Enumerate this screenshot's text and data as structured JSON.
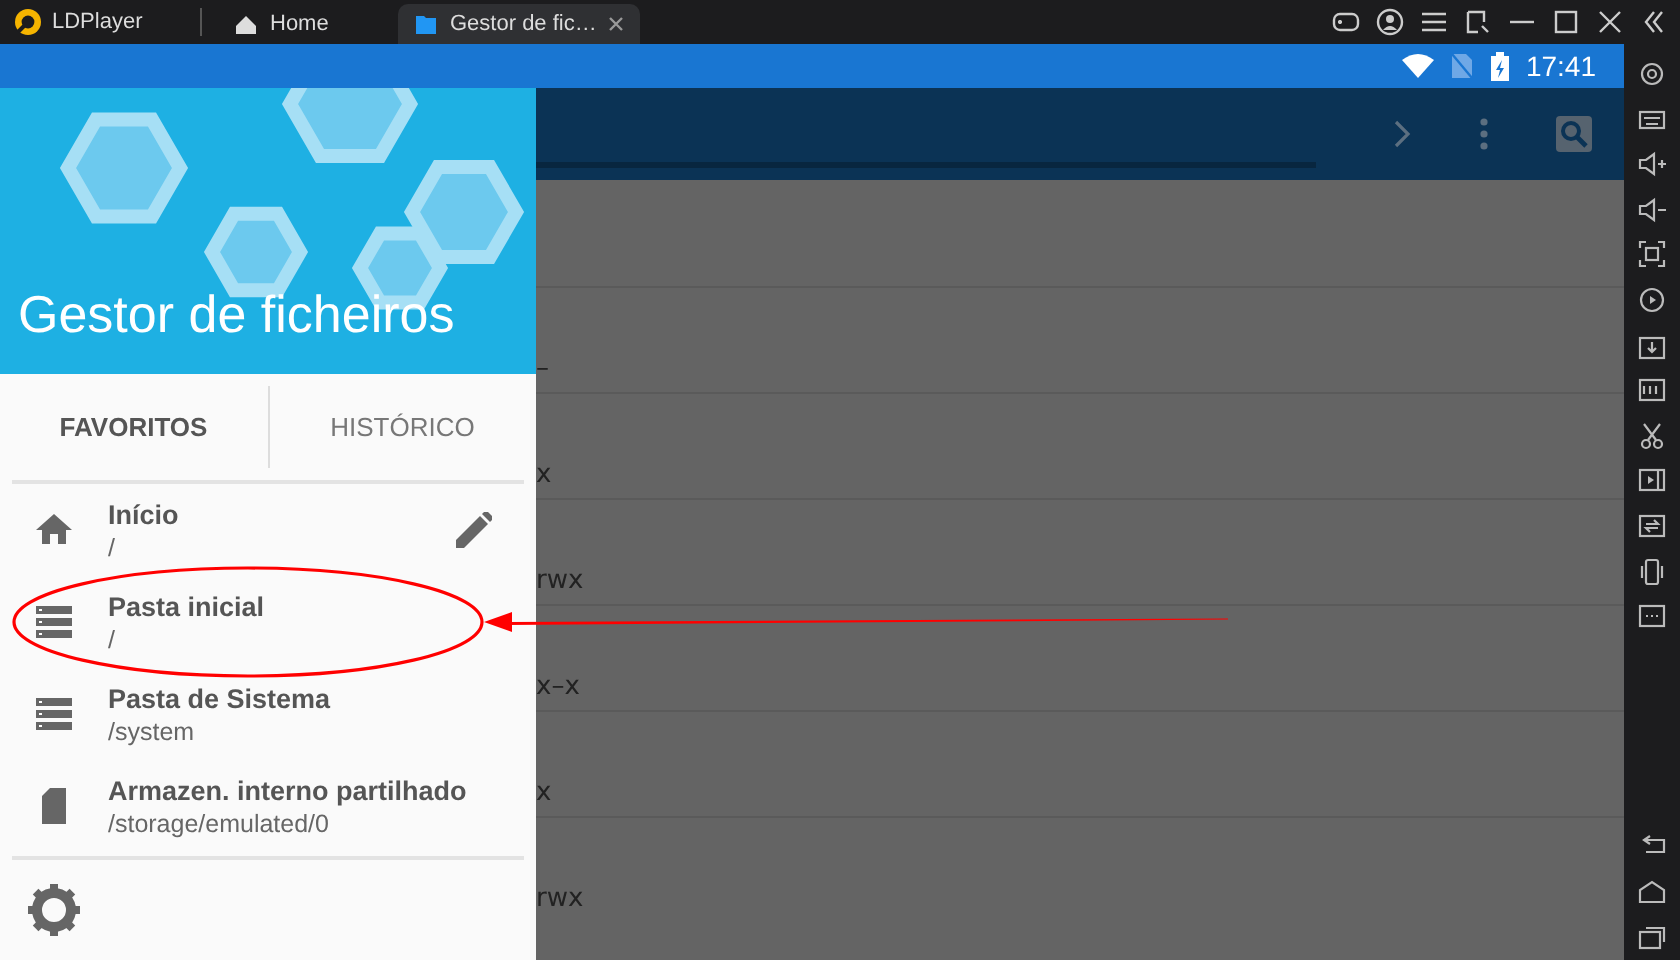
{
  "title_bar": {
    "app_name": "LDPlayer",
    "tabs": [
      {
        "label": "Home",
        "kind": "home",
        "selected": false,
        "closable": false
      },
      {
        "label": "Gestor de fic…",
        "kind": "folder",
        "selected": true,
        "closable": true
      }
    ]
  },
  "status_bar": {
    "time": "17:41"
  },
  "file_list": {
    "rows": [
      {
        "text": "–"
      },
      {
        "text": "x"
      },
      {
        "text": "rwx"
      },
      {
        "text": "x–x"
      },
      {
        "text": "x"
      },
      {
        "text": "rwx"
      }
    ]
  },
  "drawer": {
    "title": "Gestor de ficheiros",
    "tabs": [
      {
        "label": "FAVORITOS",
        "selected": true
      },
      {
        "label": "HISTÓRICO",
        "selected": false
      }
    ],
    "items": [
      {
        "kind": "home",
        "title": "Início",
        "path": "/",
        "editable": true,
        "annotated": false
      },
      {
        "kind": "storage",
        "title": "Pasta inicial",
        "path": "/",
        "editable": false,
        "annotated": true
      },
      {
        "kind": "storage",
        "title": "Pasta de Sistema",
        "path": "/system",
        "editable": false,
        "annotated": false
      },
      {
        "kind": "sdcard",
        "title": "Armazen. interno partilhado",
        "path": "/storage/emulated/0",
        "editable": false,
        "annotated": false
      }
    ]
  }
}
